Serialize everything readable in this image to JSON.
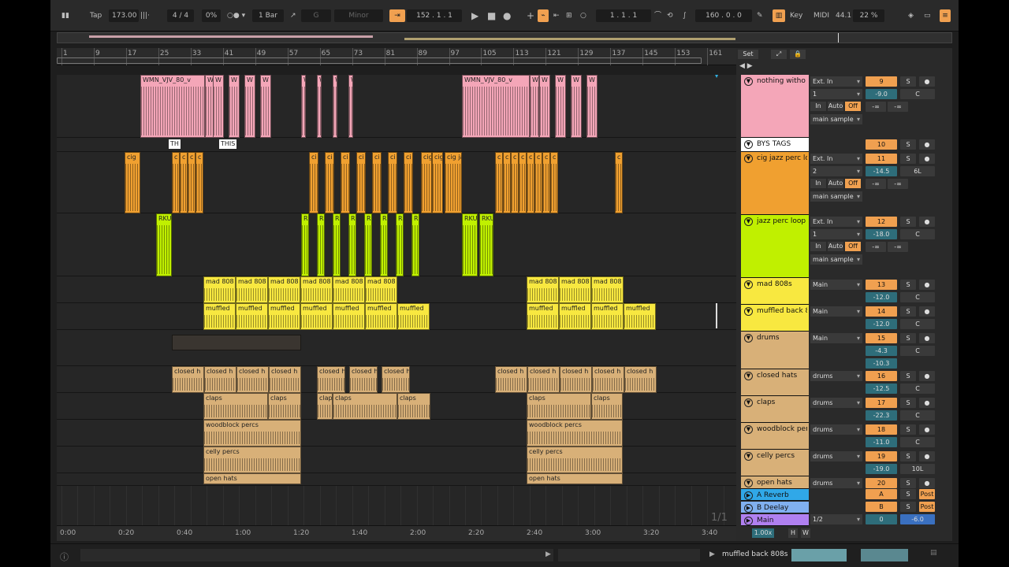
{
  "transport": {
    "tap": "Tap",
    "tempo": "173.00",
    "signature": "4 / 4",
    "swing": "0%",
    "quantize": "1 Bar",
    "key": "G",
    "scale": "Minor",
    "position": "152 .  1 .  1",
    "loop_start": "1 .  1 .  1",
    "loop_length": "160 .  0 .  0",
    "key_label": "Key",
    "midi_label": "MIDI",
    "cpu": "44.1",
    "zoom": "22 %"
  },
  "ruler": {
    "bars": [
      "1",
      "9",
      "17",
      "25",
      "33",
      "41",
      "49",
      "57",
      "65",
      "73",
      "81",
      "89",
      "97",
      "105",
      "113",
      "121",
      "129",
      "137",
      "145",
      "153",
      "161"
    ],
    "set_label": "Set"
  },
  "timebar": [
    "0:00",
    "0:20",
    "0:40",
    "1:00",
    "1:20",
    "1:40",
    "2:00",
    "2:20",
    "2:40",
    "3:00",
    "3:20",
    "3:40"
  ],
  "page_counter": "1/1",
  "tracks": [
    {
      "name": "nothing witho",
      "color": "#f4a6b8",
      "input": "Ext. In",
      "ch": "1",
      "num": "9",
      "vol": "-9.0",
      "pan": "C",
      "route": "main sample",
      "buttons": [
        "In",
        "Auto",
        "Off"
      ],
      "sends": [
        "-∞",
        "-∞"
      ]
    },
    {
      "name": "BYS TAGS",
      "color": "#ffffff",
      "num": "10"
    },
    {
      "name": "cig jazz perc lo",
      "color": "#f0a030",
      "input": "Ext. In",
      "ch": "2",
      "num": "11",
      "vol": "-14.5",
      "pan": "6L",
      "route": "main sample",
      "buttons": [
        "In",
        "Auto",
        "Off"
      ],
      "sends": [
        "-∞",
        "-∞"
      ]
    },
    {
      "name": "jazz perc loop",
      "color": "#c0f000",
      "input": "Ext. In",
      "ch": "1",
      "num": "12",
      "vol": "-18.0",
      "pan": "C",
      "route": "main sample",
      "buttons": [
        "In",
        "Auto",
        "Off"
      ],
      "sends": [
        "-∞",
        "-∞"
      ]
    },
    {
      "name": "mad 808s",
      "color": "#f8e840",
      "input": "Main",
      "num": "13",
      "vol": "-12.0",
      "pan": "C"
    },
    {
      "name": "muffled back 8",
      "color": "#f8e840",
      "input": "Main",
      "num": "14",
      "vol": "-12.0",
      "pan": "C"
    },
    {
      "name": "drums",
      "color": "#d8b078",
      "input": "Main",
      "num": "15",
      "vol": "-4.3",
      "pan": "C",
      "extra": "-10.3"
    },
    {
      "name": "closed hats",
      "color": "#d8b078",
      "input": "drums",
      "num": "16",
      "vol": "-12.5",
      "pan": "C"
    },
    {
      "name": "claps",
      "color": "#d8b078",
      "input": "drums",
      "num": "17",
      "vol": "-22.3",
      "pan": "C"
    },
    {
      "name": "woodblock per",
      "color": "#d8b078",
      "input": "drums",
      "num": "18",
      "vol": "-11.0",
      "pan": "C"
    },
    {
      "name": "celly percs",
      "color": "#d8b078",
      "input": "drums",
      "num": "19",
      "vol": "-19.0",
      "pan": "10L"
    },
    {
      "name": "open hats",
      "color": "#d8b078",
      "input": "drums",
      "num": "20"
    }
  ],
  "returns": [
    {
      "name": "A Reverb",
      "color": "#30a8e8",
      "letter": "A",
      "post": "Post"
    },
    {
      "name": "B Deelay",
      "color": "#80b0f0",
      "letter": "B",
      "post": "Post"
    },
    {
      "name": "Main",
      "color": "#b080f0",
      "route": "1/2",
      "vol": "0",
      "pan": "-6.0"
    }
  ],
  "clips": {
    "vocal_a": "WMN_VJV_80_v",
    "vocal_b": "WMN_VJV_80_v",
    "w": "W",
    "cig": "cig",
    "c": "c",
    "ci": "ci",
    "cig_jazz": "cig ja",
    "rku": "RKU",
    "r": "R",
    "mad": "mad 808",
    "muffled": "muffled",
    "closed": "closed h",
    "claps": "claps",
    "clap": "clap",
    "woodblock": "woodblock percs",
    "celly": "celly percs",
    "open": "open hats",
    "tag_th": "TH",
    "tag_this": "THIS"
  },
  "bottom": {
    "selected_track": "muffled back 808s",
    "zoom_factor": "1.00x",
    "h": "H",
    "w": "W"
  }
}
